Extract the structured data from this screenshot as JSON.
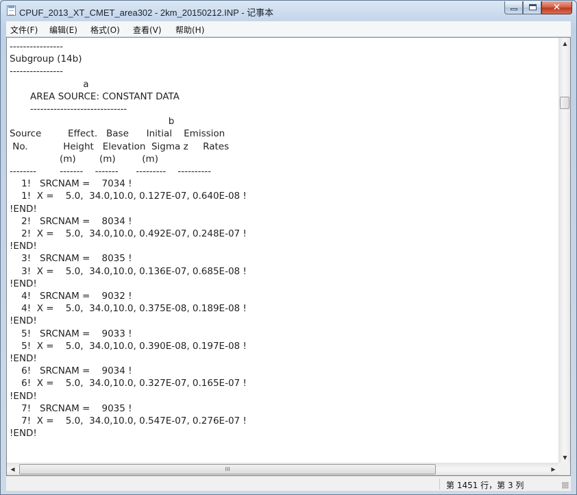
{
  "window": {
    "title": "CPUF_2013_XT_CMET_area302 - 2km_20150212.INP - 记事本",
    "icon": "notepad-icon",
    "controls": {
      "minimize": "minimize-icon",
      "maximize": "maximize-icon",
      "close_glyph": "✕"
    }
  },
  "menu": {
    "file": "文件(F)",
    "edit": "编辑(E)",
    "format": "格式(O)",
    "view": "查看(V)",
    "help": "帮助(H)"
  },
  "content": {
    "lines": [
      "----------------",
      "Subgroup (14b)",
      "----------------",
      "                         a",
      "       AREA SOURCE: CONSTANT DATA",
      "       -----------------------------",
      "                                                      b",
      "Source         Effect.   Base      Initial    Emission",
      " No.            Height   Elevation  Sigma z     Rates",
      "                 (m)        (m)         (m)",
      "--------        -------    -------      ---------    ----------",
      "    1!   SRCNAM =    7034 !",
      "    1!  X =    5.0,  34.0,10.0, 0.127E-07, 0.640E-08 !",
      "!END!",
      "    2!   SRCNAM =    8034 !",
      "    2!  X =    5.0,  34.0,10.0, 0.492E-07, 0.248E-07 !",
      "!END!",
      "    3!   SRCNAM =    8035 !",
      "    3!  X =    5.0,  34.0,10.0, 0.136E-07, 0.685E-08 !",
      "!END!",
      "    4!   SRCNAM =    9032 !",
      "    4!  X =    5.0,  34.0,10.0, 0.375E-08, 0.189E-08 !",
      "!END!",
      "    5!   SRCNAM =    9033 !",
      "    5!  X =    5.0,  34.0,10.0, 0.390E-08, 0.197E-08 !",
      "!END!",
      "    6!   SRCNAM =    9034 !",
      "    6!  X =    5.0,  34.0,10.0, 0.327E-07, 0.165E-07 !",
      "!END!",
      "    7!   SRCNAM =    9035 !",
      "    7!  X =    5.0,  34.0,10.0, 0.547E-07, 0.276E-07 !",
      "!END!"
    ]
  },
  "scrollbars": {
    "up_arrow": "▲",
    "down_arrow": "▼",
    "left_arrow": "◀",
    "right_arrow": "▶",
    "hthumb_grip": "III"
  },
  "status": {
    "position": "第 1451 行，第 3 列"
  }
}
